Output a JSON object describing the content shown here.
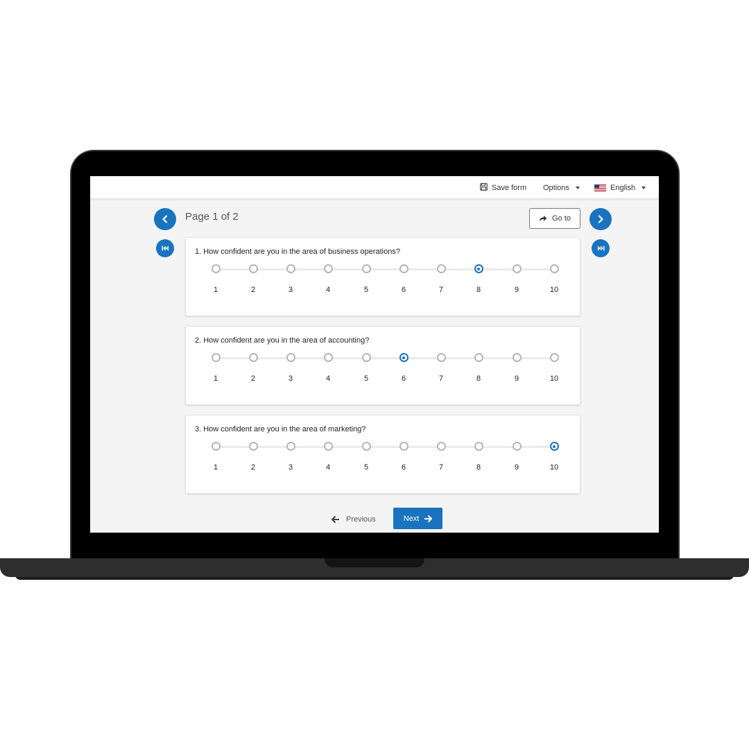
{
  "topbar": {
    "save_label": "Save form",
    "options_label": "Options",
    "language_label": "English"
  },
  "pager": {
    "title": "Page 1 of 2",
    "goto_label": "Go to"
  },
  "questions": [
    {
      "text": "1. How confident are you in the area of business operations?",
      "selected": 8
    },
    {
      "text": "2. How confident are you in the area of accounting?",
      "selected": 6
    },
    {
      "text": "3. How confident are you in the area of marketing?",
      "selected": 10
    }
  ],
  "scale": [
    "1",
    "2",
    "3",
    "4",
    "5",
    "6",
    "7",
    "8",
    "9",
    "10"
  ],
  "footer": {
    "previous_label": "Previous",
    "next_label": "Next"
  },
  "colors": {
    "accent": "#1a73be",
    "radio_unselected": "#b5b5b5"
  },
  "icons": {
    "save": "floppy-disk-icon",
    "options": "caret-down-icon",
    "language": "us-flag-icon",
    "goto": "share-arrow-icon",
    "prev_page": "chevron-left-icon",
    "next_page": "chevron-right-icon",
    "first_page": "skip-back-icon",
    "last_page": "skip-forward-icon",
    "previous": "arrow-left-icon",
    "next": "arrow-right-icon"
  }
}
